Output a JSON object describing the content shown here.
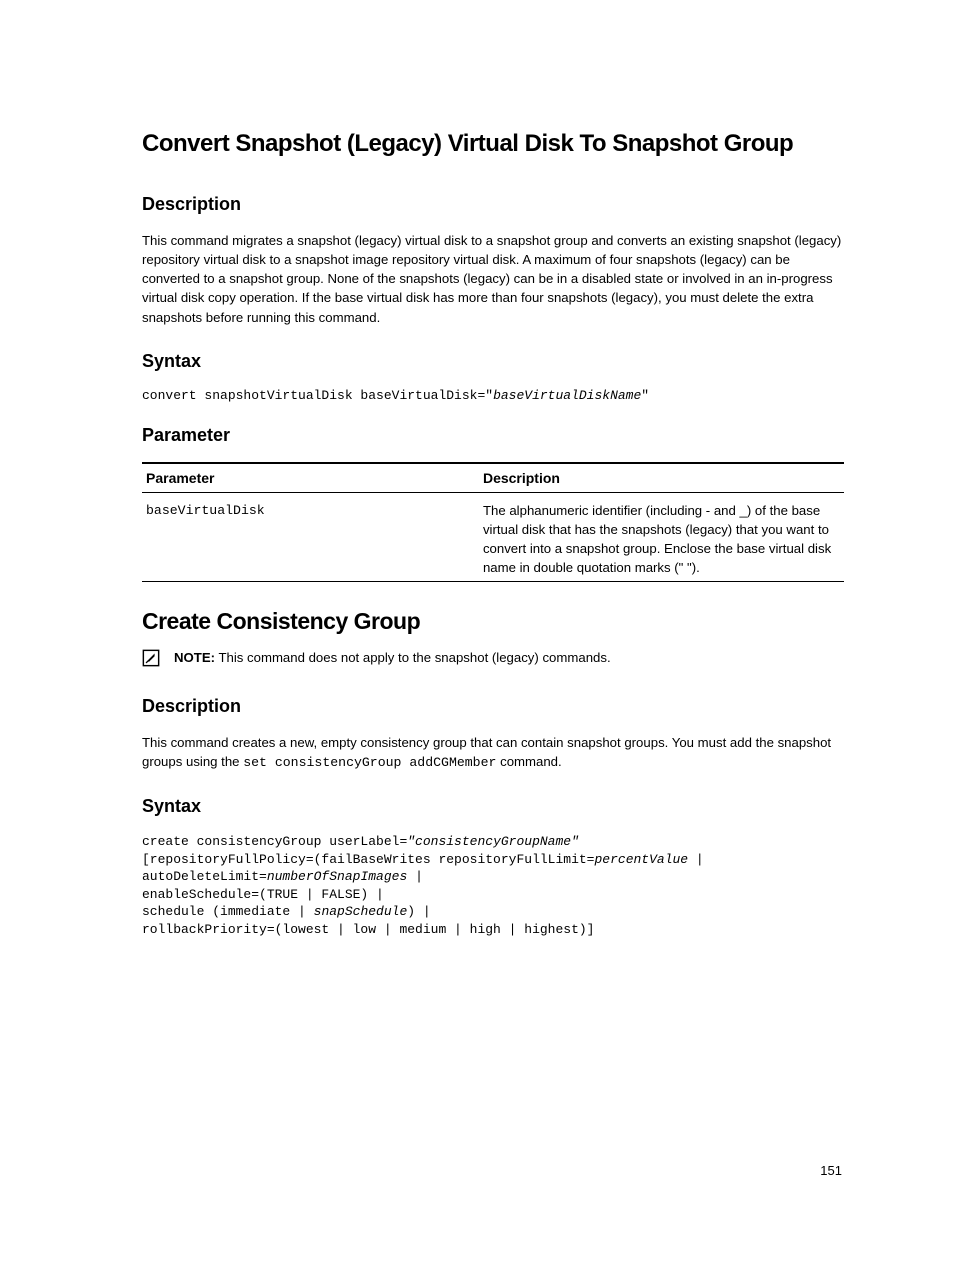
{
  "section1": {
    "title": "Convert Snapshot (Legacy) Virtual Disk To Snapshot Group",
    "desc_heading": "Description",
    "desc_body": "This command migrates a snapshot (legacy) virtual disk to a snapshot group and converts an existing snapshot (legacy) repository virtual disk to a snapshot image repository virtual disk. A maximum of four snapshots (legacy) can be converted to a snapshot group. None of the snapshots (legacy) can be in a disabled state or involved in an in-progress virtual disk copy operation. If the base virtual disk has more than four snapshots (legacy), you must delete the extra snapshots before running this command.",
    "syntax_heading": "Syntax",
    "syntax_prefix": "convert snapshotVirtualDisk baseVirtualDisk=\"",
    "syntax_italic": "baseVirtualDiskName",
    "syntax_suffix": "\"",
    "param_heading": "Parameter",
    "table": {
      "h1": "Parameter",
      "h2": "Description",
      "r1c1": "baseVirtualDisk",
      "r1c2": "The alphanumeric identifier (including - and _) of the base virtual disk that has the snapshots (legacy) that you want to convert into a snapshot group. Enclose the base virtual disk name in double quotation marks (\" \")."
    }
  },
  "section2": {
    "title": "Create Consistency Group",
    "note_label": "NOTE:",
    "note_text": " This command does not apply to the snapshot (legacy) commands.",
    "desc_heading": "Description",
    "desc_prefix": "This command creates a new, empty consistency group that can contain snapshot groups. You must add the snapshot groups using the ",
    "desc_code": "set consistencyGroup addCGMember",
    "desc_suffix": " command.",
    "syntax_heading": "Syntax",
    "code": {
      "l1a": "create consistencyGroup userLabel=",
      "l1b": "\"consistencyGroupName\"",
      "l2a": "[repositoryFullPolicy=(failBaseWrites repositoryFullLimit=",
      "l2b": "percentValue",
      "l2c": " |",
      "l3a": "autoDeleteLimit=",
      "l3b": "numberOfSnapImages",
      "l3c": " |",
      "l4": "enableSchedule=(TRUE | FALSE) |",
      "l5a": "schedule (immediate | ",
      "l5b": "snapSchedule",
      "l5c": ") |",
      "l6": "rollbackPriority=(lowest | low | medium | high | highest)]"
    }
  },
  "page_number": "151",
  "chart_data": null
}
